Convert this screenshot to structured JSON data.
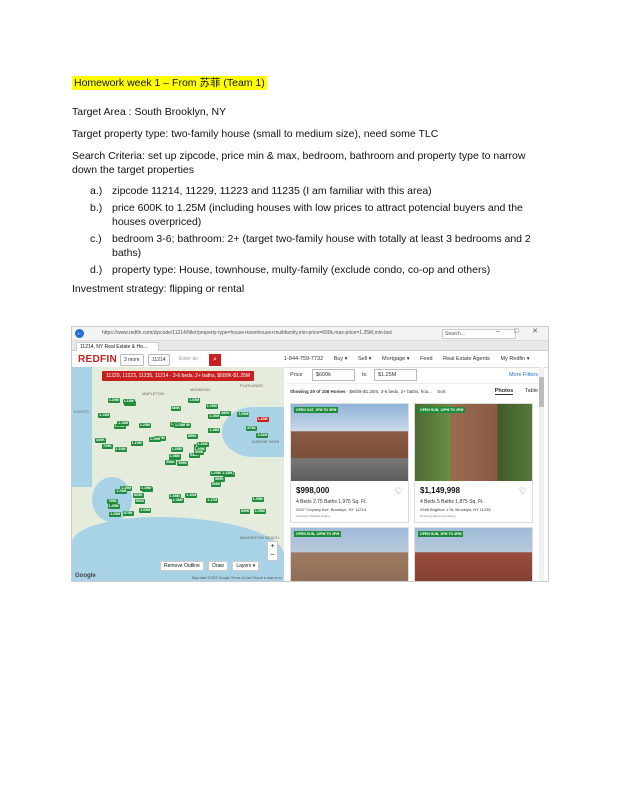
{
  "doc": {
    "title": "Homework week 1 – From 苏菲 (Team 1)",
    "target_area": "Target Area : South Brooklyn, NY",
    "target_type": "Target property type: two-family house (small to medium size), need some TLC",
    "criteria_1": "Search Criteria: set up zipcode, price min & max, bedroom, bathroom and property type to narrow",
    "criteria_2": "down the target properties",
    "items": [
      {
        "marker": "a.)",
        "text": "zipcode 11214, 11229, 11223 and 11235 (I am familiar with this area)"
      },
      {
        "marker": "b.)",
        "text": "price 600K to 1.25M (including houses with low prices to attract potencial buyers and the houses overpriced)"
      },
      {
        "marker": "c.)",
        "text": "bedroom 3-6; bathroom: 2+ (target two-family house with totally at least 3 bedrooms and 2 baths)"
      },
      {
        "marker": "d.)",
        "text": "property type: House, townhouse, multy-family (exclude condo, co-op and others)"
      }
    ],
    "strategy": "Investment strategy: flipping or rental"
  },
  "browser": {
    "url": "https://www.redfin.com/zipcode/11214/filter/property-type=house+townhouse+multifamily,min-price=600k,max-price=1.25M,min-beds=3,max-beds=6,min-baths=2",
    "tab": "11214, NY Real Estate & Ho...",
    "search_placeholder": "Search...",
    "win_controls": "– □ ✕"
  },
  "redfin": {
    "logo": "REDFIN",
    "more": "3 more",
    "zip": "11214",
    "enter": "Enter an",
    "phone": "1-844-759-7732",
    "nav": [
      "Buy ▾",
      "Sell ▾",
      "Mortgage ▾",
      "Feed",
      "Real Estate Agents",
      "My Redfin ▾"
    ],
    "filter_tag": "11229, 11223, 11235, 11214 · 3-6 beds, 2+ baths, $600K-$1.25M",
    "price_label": "Price",
    "price_min": "$600k",
    "to": "to",
    "price_max": "$1.25M",
    "more_filters": "More Filters",
    "showing": "Showing 20 of 108 Homes",
    "showing_detail": "· $600k-$1.25m, 3-6 beds, 2+ baths, hou...",
    "sort": "Sort",
    "tab_photos": "Photos",
    "tab_table": "Table",
    "map_buttons": [
      "Remove Outline",
      "Draw",
      "Layers ▾"
    ],
    "google": "Google",
    "map_footer": "Map data ©2020 Google   Terms of Use   Report a map error",
    "map_places": [
      "MAPLETON",
      "MIDWOOD",
      "FLATLANDS",
      "MARINE PARK",
      "MANHATTAN BEACH",
      "EIGHTS"
    ],
    "listings": [
      {
        "badge": "OPEN SAT, 1PM TO 3PM",
        "price": "$998,000",
        "facts": "4 Beds   2.75 Baths   1,975 Sq. Ft.",
        "addr": "2037 Cropsey Ave, Brooklyn, NY 11214",
        "agent": "Listing by Michelle Zhang"
      },
      {
        "badge": "OPEN SUN, 12PM TO 2PM",
        "price": "$1,149,998",
        "facts": "4 Beds   5 Baths   1,875 Sq. Ft.",
        "addr": "2948 Brighton 1 St, Brooklyn, NY 11235",
        "agent": "Listing by Mei Fong Huang"
      }
    ],
    "listings_row2": [
      "OPEN SUN, 12PM TO 2PM",
      "OPEN SUN, 1PM TO 3PM"
    ],
    "map_prices": [
      "999K",
      "1.20M",
      "1.20M",
      "795K",
      "1.10M",
      "869K",
      "1.05M",
      "1.20M",
      "1.19M",
      "948K",
      "1.23M",
      "1.05M",
      "1.10M",
      "1.20M",
      "998K",
      "1.18M",
      "875K",
      "1.10M",
      "899K",
      "1.15M",
      "1.00M",
      "1.25M",
      "950K",
      "1.13M",
      "1.20M",
      "1.09M",
      "1.10M",
      "885K",
      "729K",
      "1.20M",
      "1.02M",
      "1.08M",
      "1.08M",
      "1.20M",
      "1.20M",
      "880K",
      "1.15M",
      "899K",
      "1.25M",
      "1.13M",
      "1.05M",
      "1.10M",
      "1.10M",
      "949K",
      "1.09M",
      "849K",
      "1.20M",
      "1.25M",
      "1.08M",
      "999K",
      "1.24M",
      "875K",
      "1.13M",
      "899K",
      "1.17M",
      "865K",
      "1.19M",
      "1.20M",
      "1.10M",
      "1.05M"
    ]
  }
}
